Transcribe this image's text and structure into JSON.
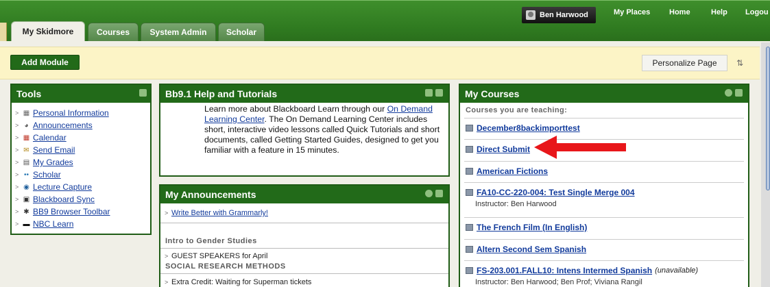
{
  "user": {
    "name": "Ben Harwood"
  },
  "toplinks": [
    "My Places",
    "Home",
    "Help",
    "Logou"
  ],
  "tabs": [
    "My Skidmore",
    "Courses",
    "System Admin",
    "Scholar"
  ],
  "toolbar": {
    "add_module": "Add Module",
    "personalize": "Personalize Page",
    "reorder_icon": "⇅"
  },
  "tools": {
    "title": "Tools",
    "items": [
      {
        "icon": "personal-info-icon",
        "glyph": "▦",
        "label": "Personal Information",
        "color": "#6b6b6b"
      },
      {
        "icon": "announcements-icon",
        "glyph": "◕",
        "label": "Announcements",
        "color": "#555"
      },
      {
        "icon": "calendar-icon",
        "glyph": "▦",
        "label": "Calendar",
        "color": "#c0392b"
      },
      {
        "icon": "envelope-icon",
        "glyph": "✉",
        "label": "Send Email",
        "color": "#b48a1c"
      },
      {
        "icon": "grades-icon",
        "glyph": "▤",
        "label": "My Grades",
        "color": "#555"
      },
      {
        "icon": "scholar-icon",
        "glyph": "••",
        "label": "Scholar",
        "color": "#2a7ab5"
      },
      {
        "icon": "lecture-capture-icon",
        "glyph": "◉",
        "label": "Lecture Capture",
        "color": "#1f5f9c"
      },
      {
        "icon": "blackboard-sync-icon",
        "glyph": "▣",
        "label": "Blackboard Sync",
        "color": "#333"
      },
      {
        "icon": "toolbar-icon",
        "glyph": "✱",
        "label": "BB9 Browser Toolbar",
        "color": "#333"
      },
      {
        "icon": "nbc-learn-icon",
        "glyph": "▬",
        "label": "NBC Learn",
        "color": "#111"
      }
    ]
  },
  "help": {
    "title": "Bb9.1 Help and Tutorials",
    "pre": "Learn more about Blackboard Learn through our ",
    "link": "On Demand Learning Center",
    "post": ". The On Demand Learning Center includes short, interactive video lessons called Quick Tutorials and short documents, called Getting Started Guides, designed to get you familiar with a feature in 15 minutes."
  },
  "announcements": {
    "title": "My Announcements",
    "top_item": "Write Better with Grammarly!",
    "groups": [
      {
        "heading": "Intro to Gender Studies",
        "item": "GUEST SPEAKERS for April"
      },
      {
        "heading": "SOCIAL RESEARCH METHODS",
        "item": "Extra Credit: Waiting for Superman tickets"
      }
    ]
  },
  "courses": {
    "title": "My Courses",
    "subheading": "Courses you are teaching:",
    "items": [
      {
        "name": "December8backimporttest",
        "instructor": "",
        "note": ""
      },
      {
        "name": "Direct Submit",
        "instructor": "",
        "note": ""
      },
      {
        "name": "American Fictions",
        "instructor": "",
        "note": ""
      },
      {
        "name": "FA10-CC-220-004: Test Single Merge 004",
        "instructor": "Instructor: Ben Harwood",
        "note": ""
      },
      {
        "name": "The French Film (In English)",
        "instructor": "",
        "note": ""
      },
      {
        "name": "Altern Second Sem Spanish",
        "instructor": "",
        "note": ""
      },
      {
        "name": "FS-203.001.FALL10: Intens Intermed Spanish",
        "instructor": "Instructor: Ben Harwood;  Ben Prof;  Viviana Rangil",
        "note": "(unavailable)"
      }
    ]
  },
  "annotation": {
    "arrow_color": "#e8161a"
  }
}
